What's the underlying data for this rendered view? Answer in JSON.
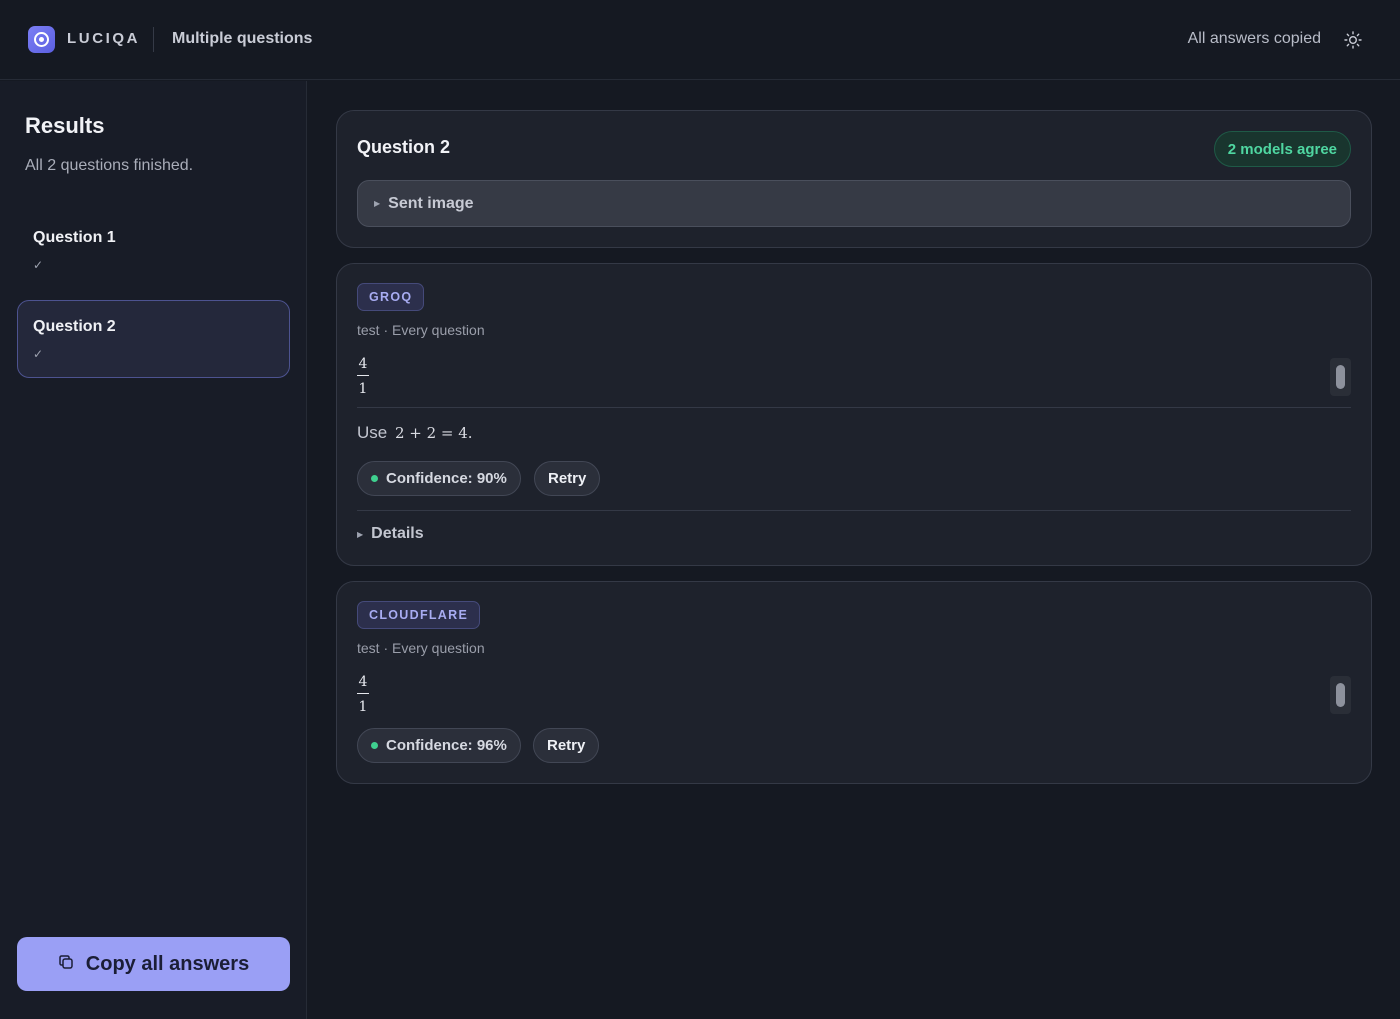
{
  "header": {
    "brand": "LUCIQA",
    "mode": "Multiple questions",
    "status": "All answers copied",
    "theme_icon": "sun-icon"
  },
  "sidebar": {
    "title": "Results",
    "subtitle": "All 2 questions finished.",
    "items": [
      {
        "label": "Question 1",
        "status": "✓",
        "active": false
      },
      {
        "label": "Question 2",
        "status": "✓",
        "active": true
      }
    ],
    "copy_all": "Copy all answers"
  },
  "question_card": {
    "title": "Question 2",
    "agreement": "2 models agree",
    "sent_image": "Sent image"
  },
  "answers": [
    {
      "provider": "GROQ",
      "meta": "test · Every question",
      "answer_num": "4",
      "answer_den": "1",
      "explanation_prefix": "Use",
      "explanation_math": "2 + 2 = 4.",
      "confidence": "Confidence: 90%",
      "retry": "Retry",
      "details": "Details"
    },
    {
      "provider": "CLOUDFLARE",
      "meta": "test · Every question",
      "answer_num": "4",
      "answer_den": "1",
      "confidence": "Confidence: 96%",
      "retry": "Retry"
    }
  ],
  "colors": {
    "accent": "#9a9ff5",
    "agree_green": "#4fd6a1",
    "confidence_dot": "#3fd08f",
    "background": "#151922"
  }
}
